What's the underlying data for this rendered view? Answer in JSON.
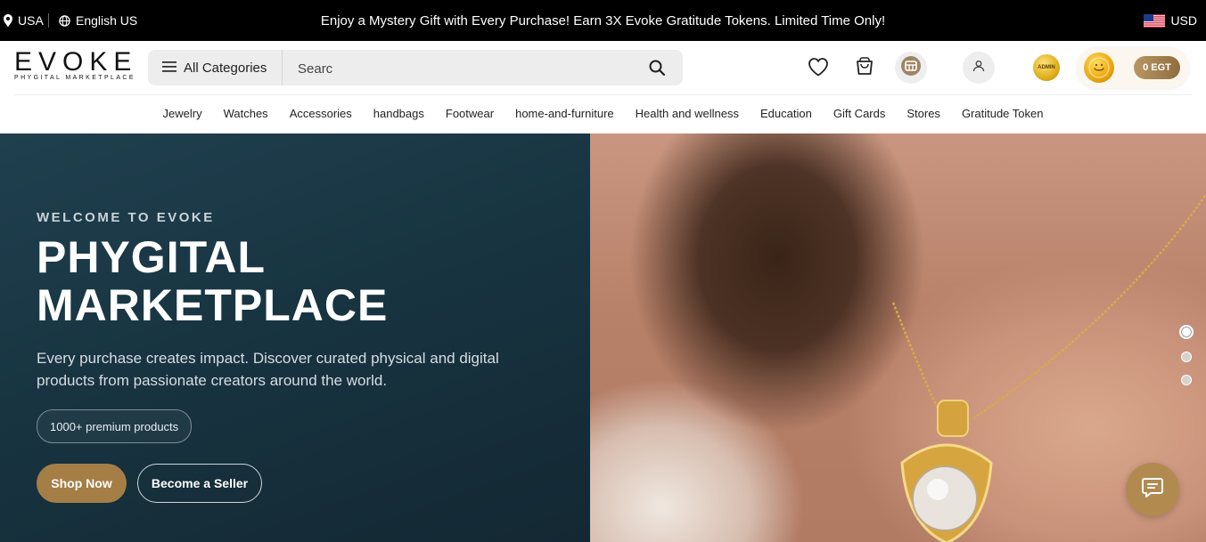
{
  "topbar": {
    "location": "USA",
    "language": "English US",
    "promo": "Enjoy a Mystery Gift with Every Purchase! Earn 3X Evoke Gratitude Tokens. Limited Time Only!",
    "currency": "USD"
  },
  "header": {
    "logo_text": "EVOKE",
    "logo_tagline": "PHYGITAL MARKETPLACE",
    "categories_label": "All Categories",
    "search_value": "Searc",
    "admin_label": "ADMIN",
    "token_balance": "0 EGT"
  },
  "nav": {
    "items": [
      "Jewelry",
      "Watches",
      "Accessories",
      "handbags",
      "Footwear",
      "home-and-furniture",
      "Health and wellness",
      "Education",
      "Gift Cards",
      "Stores",
      "Gratitude Token"
    ]
  },
  "hero": {
    "eyebrow": "WELCOME TO EVOKE",
    "title_line1": "PHYGITAL",
    "title_line2": "MARKETPLACE",
    "description": "Every purchase creates impact. Discover curated physical and digital products from passionate creators around the world.",
    "badge": "1000+ premium products",
    "primary_cta": "Shop Now",
    "secondary_cta": "Become a Seller",
    "slides_total": 3,
    "active_slide": 1
  },
  "colors": {
    "topbar_bg": "#000000",
    "hero_bg": "#1b3744",
    "accent_gold": "#a57e46"
  }
}
